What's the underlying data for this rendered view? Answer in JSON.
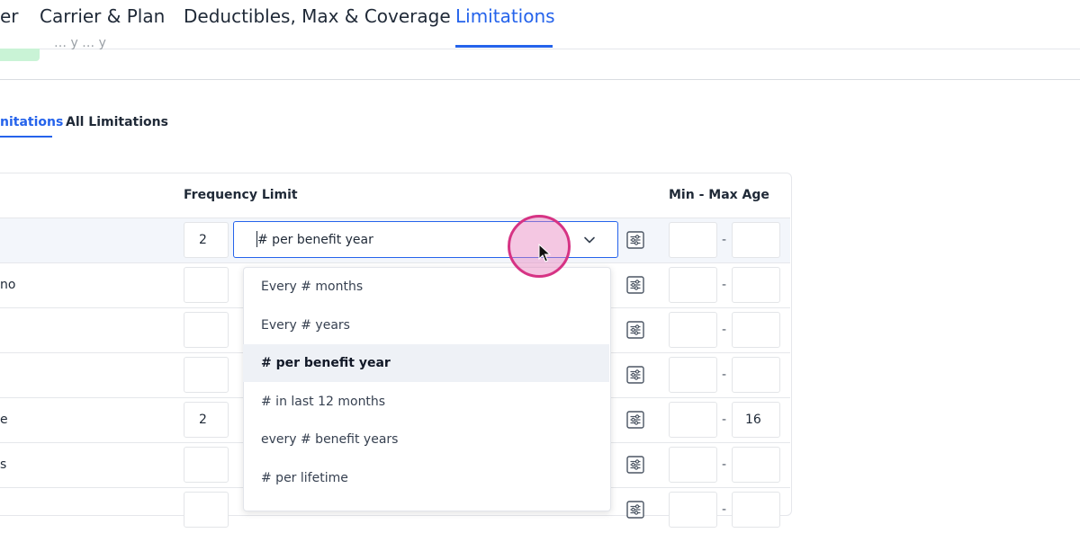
{
  "top_tabs": [
    {
      "label": "er"
    },
    {
      "label": "Carrier & Plan"
    },
    {
      "label": "Deductibles, Max & Coverage"
    },
    {
      "label": "Limitations"
    }
  ],
  "faded_text": "… y … y",
  "sub_tabs": [
    {
      "label": "nitations"
    },
    {
      "label": "All Limitations"
    }
  ],
  "table": {
    "headers": {
      "frequency": "Frequency Limit",
      "age": "Min - Max Age"
    },
    "age_separator": "-",
    "rows": [
      {
        "label": "",
        "freq": "2",
        "min_age": "",
        "max_age": ""
      },
      {
        "label": "no",
        "freq": "",
        "min_age": "",
        "max_age": ""
      },
      {
        "label": "",
        "freq": "",
        "min_age": "",
        "max_age": ""
      },
      {
        "label": "",
        "freq": "",
        "min_age": "",
        "max_age": ""
      },
      {
        "label": "e",
        "freq": "2",
        "min_age": "",
        "max_age": "16"
      },
      {
        "label": "s",
        "freq": "",
        "min_age": "",
        "max_age": ""
      },
      {
        "label": "",
        "freq": "",
        "min_age": "",
        "max_age": ""
      }
    ]
  },
  "select": {
    "value": "# per benefit year",
    "options": [
      "Every # months",
      "Every # years",
      "# per benefit year",
      "# in last 12 months",
      "every # benefit years",
      "# per lifetime"
    ],
    "selected_option": "# per benefit year"
  },
  "colors": {
    "accent": "#2563eb",
    "cursor_highlight": "#d63384"
  }
}
